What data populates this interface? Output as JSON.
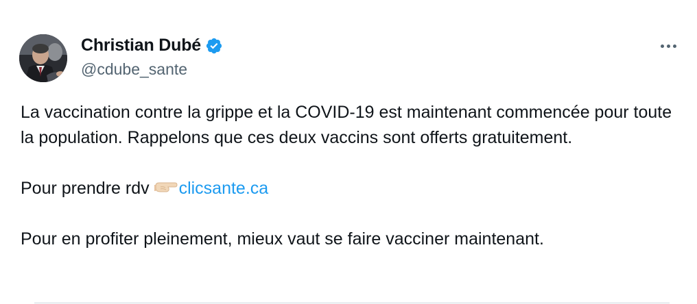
{
  "author": {
    "display_name": "Christian Dubé",
    "handle": "@cdube_sante",
    "verified_icon": "verified-badge-icon",
    "badge_color": "#1d9bf0"
  },
  "menu": {
    "icon": "more-options-icon"
  },
  "tweet": {
    "line1": "La vaccination contre la grippe et la COVID-19 est maintenant commencée pour toute la population. Rappelons que ces deux vaccins sont offerts gratuitement.",
    "line2_prefix": "Pour prendre rdv",
    "line2_emoji": "backhand-index-pointing-right",
    "line2_link": "clicsante.ca",
    "line3": "Pour en profiter pleinement, mieux vaut se faire vacciner maintenant."
  },
  "colors": {
    "text": "#0f1419",
    "secondary": "#536471",
    "link": "#1d9bf0"
  }
}
